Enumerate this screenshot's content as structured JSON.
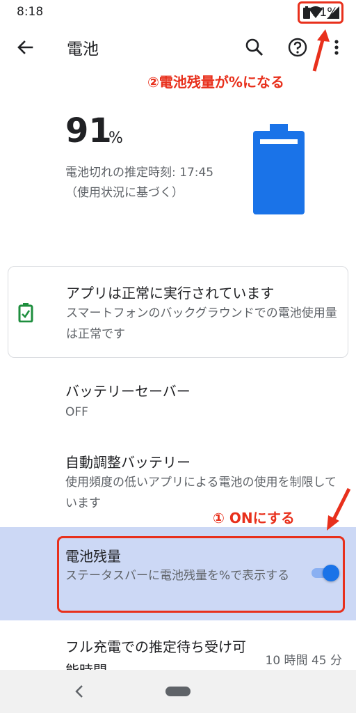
{
  "status_bar": {
    "time": "8:18",
    "battery_percent": "91%"
  },
  "app_bar": {
    "title": "電池",
    "back_icon": "arrow-back-icon",
    "search_icon": "search-icon",
    "help_icon": "help-icon",
    "more_icon": "more-vert-icon"
  },
  "battery": {
    "level_value": "91",
    "level_unit": "%",
    "level_fraction": 0.91,
    "estimate": "電池切れの推定時刻: 17:45（使用状況に基づく）"
  },
  "status_card": {
    "title": "アプリは正常に実行されています",
    "description": "スマートフォンのバックグラウンドでの電池使用量は正常です"
  },
  "preferences": [
    {
      "title": "バッテリーセーバー",
      "summary": "OFF"
    },
    {
      "title": "自動調整バッテリー",
      "summary": "使用頻度の低いアプリによる電池の使用を制限しています"
    },
    {
      "title": "電池残量",
      "summary": "ステータスバーに電池残量を%で表示する",
      "toggle_on": true
    },
    {
      "title": "フル充電での推定待ち受け可能時間",
      "value": "10 時間 45 分"
    }
  ],
  "annotations": {
    "step1": "① ONにする",
    "step2": "②電池残量が%になる"
  },
  "colors": {
    "accent": "#1a73e8",
    "annotation_red": "#e8301c",
    "highlight_bg": "#ccd8f5",
    "card_icon_green": "#1e8e3e"
  }
}
